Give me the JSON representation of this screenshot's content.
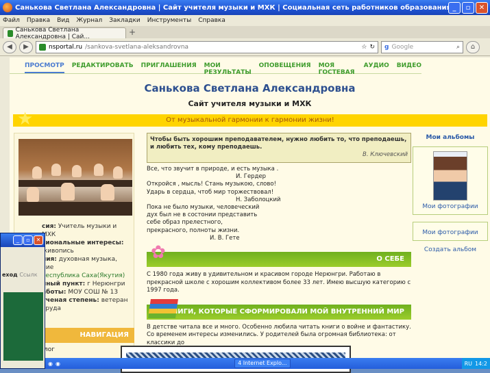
{
  "window": {
    "title": "Санькова Светлана Александровна | Сайт учителя музыки и МХК | Социальная сеть работников образования - Mozilla Firefox"
  },
  "menu": [
    "Файл",
    "Правка",
    "Вид",
    "Журнал",
    "Закладки",
    "Инструменты",
    "Справка"
  ],
  "tab": {
    "label": "Санькова Светлана Александровна | Сай...",
    "new": "+"
  },
  "address": {
    "domain": "nsportal.ru",
    "path": "/sankova-svetlana-aleksandrovna",
    "search_placeholder": "Google"
  },
  "site_nav": [
    "ПРОСМОТР",
    "РЕДАКТИРОВАТЬ",
    "ПРИГЛАШЕНИЯ",
    "МОИ РЕЗУЛЬТАТЫ",
    "ОПОВЕЩЕНИЯ",
    "МОЯ ГОСТЕВАЯ",
    "АУДИО",
    "ВИДЕО"
  ],
  "header": {
    "name": "Санькова Светлана Александровна",
    "subtitle": "Сайт учителя музыки и МХК",
    "motto": "От музыкальной гармонии к гармонии жизни!"
  },
  "profile": [
    {
      "label": "сия:",
      "value": "Учитель музыки и МХК"
    },
    {
      "label": "сиональные интересы:",
      "value": "живопись"
    },
    {
      "label": "ния:",
      "value": "духовная музыка,"
    },
    {
      "label": "",
      "value": "ние"
    },
    {
      "label": "",
      "value": "Республика Саха(Якутия)"
    },
    {
      "label": "нный пункт:",
      "value": "г Нерюнгри"
    },
    {
      "label": "аботы:",
      "value": "МОУ СОШ № 13"
    },
    {
      "label": "ученая степень:",
      "value": "ветеран труда"
    }
  ],
  "left_nav": {
    "heading": "НАВИГАЦИЯ",
    "item": "лог"
  },
  "quote": {
    "text": "Чтобы быть хорошим преподавателем, нужно любить то, что преподаешь, и любить тех, кому преподаешь.",
    "author": "В. Ключевский"
  },
  "poem": [
    {
      "t": "Все, что звучит в природе, и есть музыка .",
      "cls": ""
    },
    {
      "t": "И. Гердер",
      "cls": "c"
    },
    {
      "t": "Откройся , мысль! Стань музыкою, слово!",
      "cls": ""
    },
    {
      "t": "Ударь в сердца, чтоб мир торжествовал!",
      "cls": ""
    },
    {
      "t": "Н. Заболоцкий",
      "cls": "c"
    },
    {
      "t": "Пока не было музыки, человеческий",
      "cls": ""
    },
    {
      "t": "дух был не в состонии представить",
      "cls": ""
    },
    {
      "t": "себе образ прелестного,",
      "cls": ""
    },
    {
      "t": "прекрасного, полноты жизни.",
      "cls": ""
    },
    {
      "t": "И. В. Гете",
      "cls": "c2"
    }
  ],
  "about": {
    "heading": "О СЕБЕ",
    "text": "С 1980 года живу  в удивительном и красивом городе Нерюнгри. Работаю в прекрасной школе с хорошим коллективом более 33 лет. Имею высшую категорию с 1997 года."
  },
  "books": {
    "heading": "КНИГИ, КОТОРЫЕ СФОРМИРОВАЛИ МОЙ ВНУТРЕННИЙ МИР",
    "text": "В детстве читала все и много. Особенно любила читать книги о войне и фантастику. Со временем интересы изменились. У родителей была огромная библиотека: от классики до"
  },
  "albums": {
    "title": "Мои альбомы",
    "photos": "Мои фотографии",
    "photos2": "Мои фотографии",
    "create": "Создать альбом"
  },
  "overlay_window": {
    "link1": "еход",
    "link2": "Ссылк"
  },
  "taskbar": {
    "tasks": [
      "4 Internet Explo..."
    ],
    "lang": "RU",
    "clock": "14:2"
  }
}
